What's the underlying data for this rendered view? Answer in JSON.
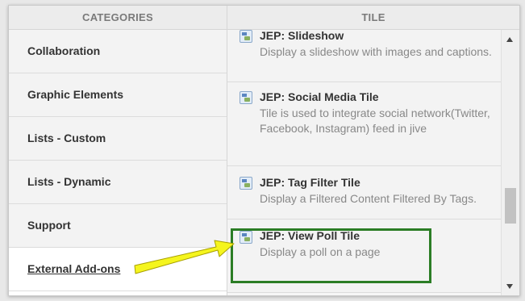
{
  "categories": {
    "header": "CATEGORIES",
    "items": [
      {
        "label": "Collaboration",
        "selected": false
      },
      {
        "label": "Graphic Elements",
        "selected": false
      },
      {
        "label": "Lists - Custom",
        "selected": false
      },
      {
        "label": "Lists - Dynamic",
        "selected": false
      },
      {
        "label": "Support",
        "selected": false
      },
      {
        "label": "External Add-ons",
        "selected": true
      }
    ]
  },
  "tiles": {
    "header": "TILE",
    "items": [
      {
        "title": "JEP: Slideshow",
        "description": "Display a slideshow with images and captions.",
        "icon": "tile-plugin-icon"
      },
      {
        "title": "JEP: Social Media Tile",
        "description": "Tile is used to integrate social network(Twitter, Facebook, Instagram) feed in jive",
        "icon": "tile-plugin-icon"
      },
      {
        "title": "JEP: Tag Filter Tile",
        "description": "Display a Filtered Content Filtered By Tags.",
        "icon": "tile-plugin-icon"
      },
      {
        "title": "JEP: View Poll Tile",
        "description": "Display a poll on a page",
        "icon": "tile-plugin-icon"
      }
    ]
  },
  "annotations": {
    "highlight_color": "#2b7d25",
    "arrow_color": "#f5f51e"
  }
}
